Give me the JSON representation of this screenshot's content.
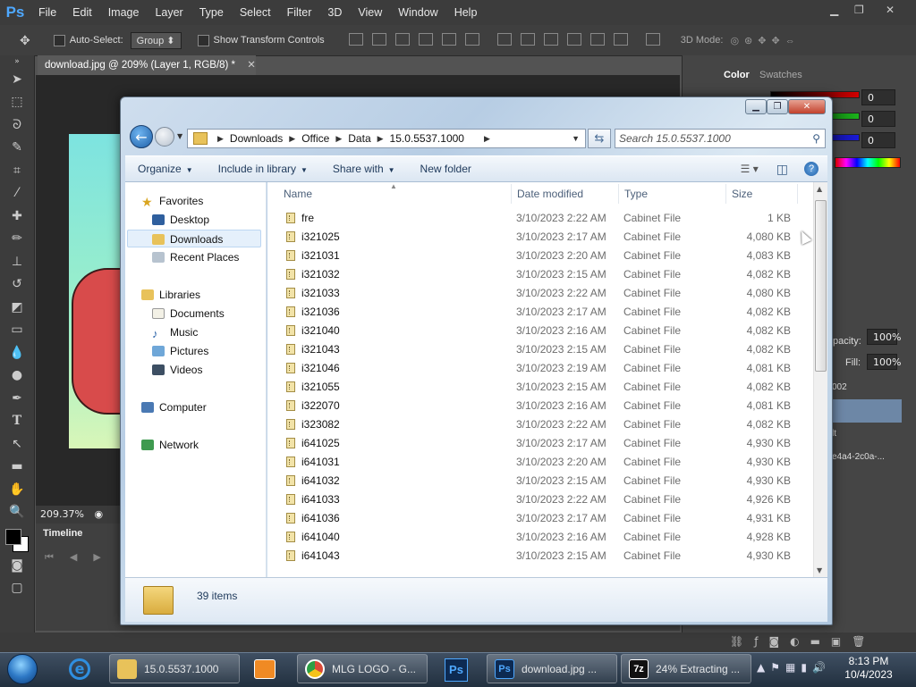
{
  "photoshop": {
    "logo": "Ps",
    "menu": [
      "File",
      "Edit",
      "Image",
      "Layer",
      "Type",
      "Select",
      "Filter",
      "3D",
      "View",
      "Window",
      "Help"
    ],
    "options": {
      "auto_select_label": "Auto-Select:",
      "auto_select_value": "Group",
      "show_transform_label": "Show Transform Controls",
      "mode_3d_label": "3D Mode:"
    },
    "document_tab": "download.jpg @ 209% (Layer 1, RGB/8) *",
    "zoom": "209.37%",
    "timeline_label": "Timeline",
    "panels": {
      "color_tab": "Color",
      "swatches_tab": "Swatches",
      "r_value": "0",
      "g_value": "0",
      "b_value": "0",
      "opacity_label": "pacity:",
      "opacity_value": "100%",
      "fill_label": "Fill:",
      "fill_value": "100%",
      "layer_rows": [
        "002",
        "",
        "lt",
        "e4a4-2c0a-..."
      ]
    }
  },
  "explorer": {
    "breadcrumbs": [
      "Downloads",
      "Office",
      "Data",
      "15.0.5537.1000"
    ],
    "search_placeholder": "Search 15.0.5537.1000",
    "commands": {
      "organize": "Organize",
      "include_in_library": "Include in library",
      "share_with": "Share with",
      "new_folder": "New folder"
    },
    "nav": {
      "favorites": "Favorites",
      "desktop": "Desktop",
      "downloads": "Downloads",
      "recent_places": "Recent Places",
      "libraries": "Libraries",
      "documents": "Documents",
      "music": "Music",
      "pictures": "Pictures",
      "videos": "Videos",
      "computer": "Computer",
      "network": "Network"
    },
    "columns": {
      "name": "Name",
      "date_modified": "Date modified",
      "type": "Type",
      "size": "Size"
    },
    "files": [
      {
        "name": "fre",
        "date": "3/10/2023 2:22 AM",
        "type": "Cabinet File",
        "size": "1 KB"
      },
      {
        "name": "i321025",
        "date": "3/10/2023 2:17 AM",
        "type": "Cabinet File",
        "size": "4,080 KB"
      },
      {
        "name": "i321031",
        "date": "3/10/2023 2:20 AM",
        "type": "Cabinet File",
        "size": "4,083 KB"
      },
      {
        "name": "i321032",
        "date": "3/10/2023 2:15 AM",
        "type": "Cabinet File",
        "size": "4,082 KB"
      },
      {
        "name": "i321033",
        "date": "3/10/2023 2:22 AM",
        "type": "Cabinet File",
        "size": "4,080 KB"
      },
      {
        "name": "i321036",
        "date": "3/10/2023 2:17 AM",
        "type": "Cabinet File",
        "size": "4,082 KB"
      },
      {
        "name": "i321040",
        "date": "3/10/2023 2:16 AM",
        "type": "Cabinet File",
        "size": "4,082 KB"
      },
      {
        "name": "i321043",
        "date": "3/10/2023 2:15 AM",
        "type": "Cabinet File",
        "size": "4,082 KB"
      },
      {
        "name": "i321046",
        "date": "3/10/2023 2:19 AM",
        "type": "Cabinet File",
        "size": "4,081 KB"
      },
      {
        "name": "i321055",
        "date": "3/10/2023 2:15 AM",
        "type": "Cabinet File",
        "size": "4,082 KB"
      },
      {
        "name": "i322070",
        "date": "3/10/2023 2:16 AM",
        "type": "Cabinet File",
        "size": "4,081 KB"
      },
      {
        "name": "i323082",
        "date": "3/10/2023 2:22 AM",
        "type": "Cabinet File",
        "size": "4,082 KB"
      },
      {
        "name": "i641025",
        "date": "3/10/2023 2:17 AM",
        "type": "Cabinet File",
        "size": "4,930 KB"
      },
      {
        "name": "i641031",
        "date": "3/10/2023 2:20 AM",
        "type": "Cabinet File",
        "size": "4,930 KB"
      },
      {
        "name": "i641032",
        "date": "3/10/2023 2:15 AM",
        "type": "Cabinet File",
        "size": "4,930 KB"
      },
      {
        "name": "i641033",
        "date": "3/10/2023 2:22 AM",
        "type": "Cabinet File",
        "size": "4,926 KB"
      },
      {
        "name": "i641036",
        "date": "3/10/2023 2:17 AM",
        "type": "Cabinet File",
        "size": "4,931 KB"
      },
      {
        "name": "i641040",
        "date": "3/10/2023 2:16 AM",
        "type": "Cabinet File",
        "size": "4,928 KB"
      },
      {
        "name": "i641043",
        "date": "3/10/2023 2:15 AM",
        "type": "Cabinet File",
        "size": "4,930 KB"
      }
    ],
    "status": "39 items"
  },
  "taskbar": {
    "buttons": [
      {
        "label": "15.0.5537.1000",
        "icon": "folder-icon",
        "color": "#e8c25a"
      },
      {
        "label": "MLG LOGO - G...",
        "icon": "chrome-icon",
        "color": "#d94a38"
      },
      {
        "label": "download.jpg ...",
        "icon": "photoshop-icon",
        "color": "#1c4f8c"
      },
      {
        "label": "24% Extracting ...",
        "icon": "7zip-icon",
        "color": "#111111"
      }
    ],
    "time": "8:13 PM",
    "date": "10/4/2023"
  },
  "colors": {
    "ps_accent": "#4ea8ff",
    "explorer_selection": "#e5f0fb",
    "red_bar": "#d40000",
    "green_bar": "#1bb51b",
    "blue_bar": "#1a1ad9"
  }
}
